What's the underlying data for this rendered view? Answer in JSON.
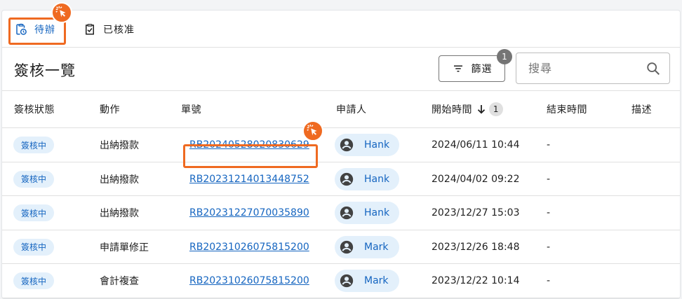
{
  "tabs": [
    {
      "label": "待辦",
      "icon": "clipboard-clock-icon",
      "active": true
    },
    {
      "label": "已核准",
      "icon": "clipboard-check-icon",
      "active": false
    }
  ],
  "page": {
    "title": "簽核一覽"
  },
  "toolbar": {
    "filter_label": "篩選",
    "filter_count": "1",
    "search_placeholder": "搜尋"
  },
  "table": {
    "headers": {
      "status": "簽核狀態",
      "action": "動作",
      "doc_no": "單號",
      "applicant": "申請人",
      "start_time": "開始時間",
      "sort_count": "1",
      "end_time": "結束時間",
      "description": "描述"
    },
    "rows": [
      {
        "status": "簽核中",
        "action": "出納撥款",
        "doc_no": "RB20240528020830629",
        "applicant": "Hank",
        "start_time": "2024/06/11 10:44",
        "end_time": "-",
        "description": ""
      },
      {
        "status": "簽核中",
        "action": "出納撥款",
        "doc_no": "RB20231214013448752",
        "applicant": "Hank",
        "start_time": "2024/04/02 09:22",
        "end_time": "-",
        "description": ""
      },
      {
        "status": "簽核中",
        "action": "出納撥款",
        "doc_no": "RB20231227070035890",
        "applicant": "Hank",
        "start_time": "2023/12/27 15:03",
        "end_time": "-",
        "description": ""
      },
      {
        "status": "簽核中",
        "action": "申請單修正",
        "doc_no": "RB20231026075815200",
        "applicant": "Mark",
        "start_time": "2023/12/26 18:48",
        "end_time": "-",
        "description": ""
      },
      {
        "status": "簽核中",
        "action": "會計複查",
        "doc_no": "RB20231026075815200",
        "applicant": "Mark",
        "start_time": "2023/12/22 10:14",
        "end_time": "-",
        "description": ""
      }
    ]
  },
  "colors": {
    "accent": "#1565c0",
    "chip_bg": "#e3f0fb",
    "highlight": "#ef6a21"
  }
}
